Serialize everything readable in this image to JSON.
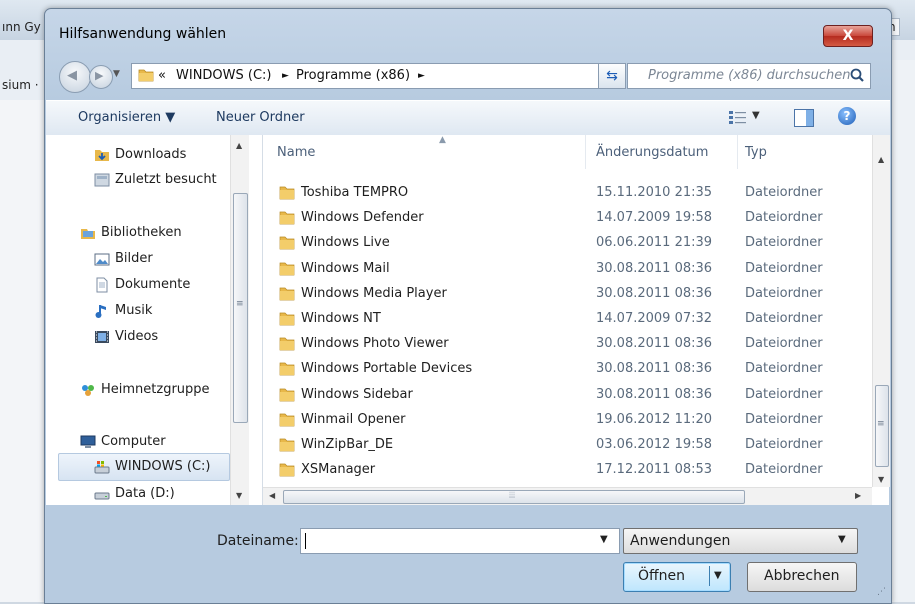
{
  "background": {
    "left_text_1": "ınn Gy",
    "left_text_2": "sium ·",
    "right_text": "ren"
  },
  "dialog": {
    "title": "Hilfsanwendung wählen",
    "close_label": "X"
  },
  "address": {
    "prefix": "«",
    "crumbs": [
      "WINDOWS (C:)",
      "Programme (x86)"
    ],
    "separator": "►",
    "search_placeholder": "Programme (x86) durchsuchen"
  },
  "toolbar": {
    "organize": "Organisieren ▼",
    "new_folder": "Neuer Ordner",
    "help": "?"
  },
  "nav": {
    "items": [
      {
        "label": "Downloads",
        "icon": "downloads-icon"
      },
      {
        "label": "Zuletzt besucht",
        "icon": "recent-places-icon"
      },
      {
        "label": "Bibliotheken",
        "icon": "libraries-icon"
      },
      {
        "label": "Bilder",
        "icon": "pictures-icon"
      },
      {
        "label": "Dokumente",
        "icon": "documents-icon"
      },
      {
        "label": "Musik",
        "icon": "music-icon"
      },
      {
        "label": "Videos",
        "icon": "videos-icon"
      },
      {
        "label": "Heimnetzgruppe",
        "icon": "homegroup-icon"
      },
      {
        "label": "Computer",
        "icon": "computer-icon"
      },
      {
        "label": "WINDOWS (C:)",
        "icon": "drive-c-icon"
      },
      {
        "label": "Data (D:)",
        "icon": "drive-d-icon"
      }
    ],
    "selected": "WINDOWS (C:)"
  },
  "files": {
    "columns": [
      "Name",
      "Änderungsdatum",
      "Typ"
    ],
    "rows": [
      {
        "name": "Toshiba TEMPRO",
        "date": "15.11.2010 21:35",
        "type": "Dateiordner"
      },
      {
        "name": "Windows Defender",
        "date": "14.07.2009 19:58",
        "type": "Dateiordner"
      },
      {
        "name": "Windows Live",
        "date": "06.06.2011 21:39",
        "type": "Dateiordner"
      },
      {
        "name": "Windows Mail",
        "date": "30.08.2011 08:36",
        "type": "Dateiordner"
      },
      {
        "name": "Windows Media Player",
        "date": "30.08.2011 08:36",
        "type": "Dateiordner"
      },
      {
        "name": "Windows NT",
        "date": "14.07.2009 07:32",
        "type": "Dateiordner"
      },
      {
        "name": "Windows Photo Viewer",
        "date": "30.08.2011 08:36",
        "type": "Dateiordner"
      },
      {
        "name": "Windows Portable Devices",
        "date": "30.08.2011 08:36",
        "type": "Dateiordner"
      },
      {
        "name": "Windows Sidebar",
        "date": "30.08.2011 08:36",
        "type": "Dateiordner"
      },
      {
        "name": "Winmail Opener",
        "date": "19.06.2012 11:20",
        "type": "Dateiordner"
      },
      {
        "name": "WinZipBar_DE",
        "date": "03.06.2012 19:58",
        "type": "Dateiordner"
      },
      {
        "name": "XSManager",
        "date": "17.12.2011 08:53",
        "type": "Dateiordner"
      }
    ]
  },
  "bottom": {
    "filename_label": "Dateiname:",
    "filename_value": "",
    "filetype": "Anwendungen",
    "open": "Öffnen",
    "cancel": "Abbrechen"
  },
  "colors": {
    "folder": "#e8b84a",
    "accent": "#1d5db6",
    "close": "#c9473a"
  }
}
